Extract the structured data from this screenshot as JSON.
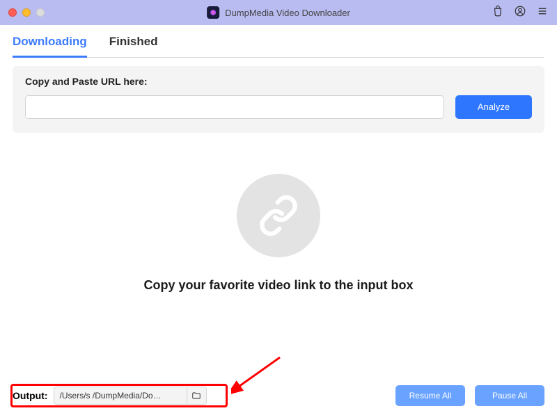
{
  "titlebar": {
    "app_title": "DumpMedia Video Downloader"
  },
  "tabs": {
    "downloading": "Downloading",
    "finished": "Finished"
  },
  "url_panel": {
    "label": "Copy and Paste URL here:",
    "input_value": "",
    "analyze_label": "Analyze"
  },
  "empty_state": {
    "message": "Copy your favorite video link to the input box"
  },
  "output": {
    "label": "Output:",
    "path": "/Users/s           /DumpMedia/Do…"
  },
  "bottom_buttons": {
    "resume": "Resume All",
    "pause": "Pause All"
  }
}
